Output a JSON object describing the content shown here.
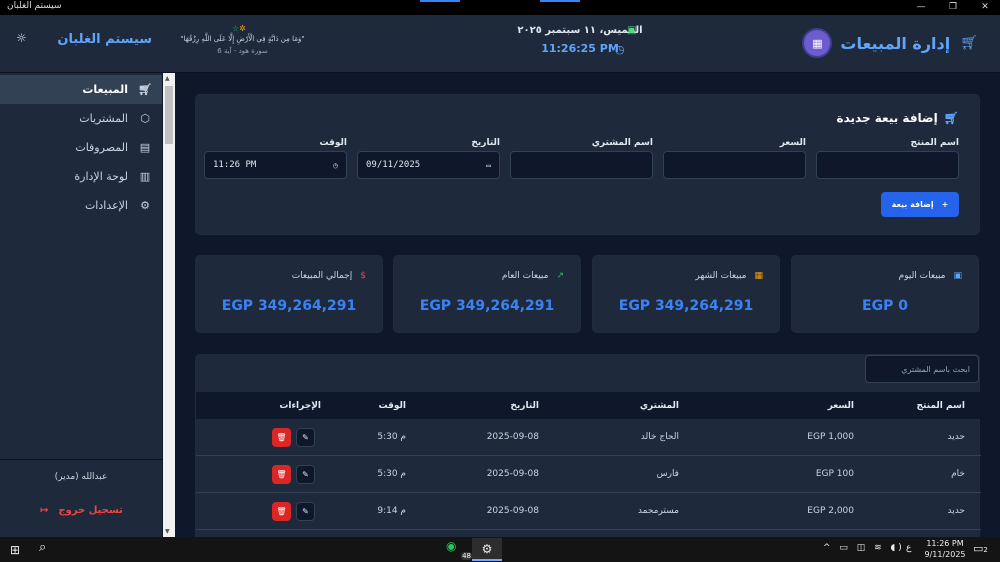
{
  "window": {
    "title": "سيستم الغلبان",
    "controls": [
      "—",
      "❐",
      "✕"
    ]
  },
  "header": {
    "title": "إدارة المبيعات",
    "date": "الخميس، ١١ سبتمبر ٢٠٢٥",
    "time": "11:26:25 PM",
    "quote": "\"وَمَا مِن دَابَّةٍ فِي الْأَرْضِ إِلَّا عَلَى اللَّهِ رِزْقُهَا\"",
    "quote_source": "سورة هود - آية 6"
  },
  "sidebar": {
    "brand": "سيستم الغلبان",
    "items": [
      {
        "label": "المبيعات",
        "icon": "cart-icon",
        "active": true
      },
      {
        "label": "المشتريات",
        "icon": "box-icon",
        "active": false
      },
      {
        "label": "المصروفات",
        "icon": "receipt-icon",
        "active": false
      },
      {
        "label": "لوحة الإدارة",
        "icon": "chart-icon",
        "active": false
      },
      {
        "label": "الإعدادات",
        "icon": "gear-icon",
        "active": false
      }
    ],
    "user": "عبدالله (مدير)",
    "logout": "تسجيل خروج"
  },
  "form": {
    "title": "إضافة بيعة جديدة",
    "fields": {
      "product": {
        "label": "اسم المنتج",
        "value": ""
      },
      "price": {
        "label": "السعر",
        "value": ""
      },
      "buyer": {
        "label": "اسم المشتري",
        "value": ""
      },
      "date": {
        "label": "التاريخ",
        "value": "09/11/2025"
      },
      "time": {
        "label": "الوقت",
        "value": "11:26 PM"
      }
    },
    "submit": "إضافة بيعة"
  },
  "stats": [
    {
      "label": "مبيعات اليوم",
      "value": "EGP 0",
      "icon": "calendar-icon",
      "icon_color": "#60a5fa"
    },
    {
      "label": "مبيعات الشهر",
      "value": "EGP 349,264,291",
      "icon": "calendar-month-icon",
      "icon_color": "#f59e0b"
    },
    {
      "label": "مبيعات العام",
      "value": "EGP 349,264,291",
      "icon": "trend-up-icon",
      "icon_color": "#22c55e"
    },
    {
      "label": "إجمالي المبيعات",
      "value": "EGP 349,264,291",
      "icon": "dollar-icon",
      "icon_color": "#ef4444"
    }
  ],
  "table": {
    "search_placeholder": "ابحث باسم المشتري",
    "columns": {
      "product": "اسم المنتج",
      "price": "السعر",
      "buyer": "المشتري",
      "date": "التاريخ",
      "time": "الوقت",
      "actions": "الإجراءات"
    },
    "rows": [
      {
        "product": "حديد",
        "price": "EGP 1,000",
        "buyer": "الحاج خالد",
        "date": "2025-09-08",
        "time": "5:30 م"
      },
      {
        "product": "خام",
        "price": "EGP 100",
        "buyer": "فارس",
        "date": "2025-09-08",
        "time": "5:30 م"
      },
      {
        "product": "حديد",
        "price": "EGP 2,000",
        "buyer": "مسترمحمد",
        "date": "2025-09-08",
        "time": "9:14 م"
      }
    ]
  },
  "taskbar": {
    "whatsapp_badge": "48",
    "lang": "ع",
    "clock_time": "11:26 PM",
    "clock_date": "9/11/2025",
    "notifications": "2"
  }
}
